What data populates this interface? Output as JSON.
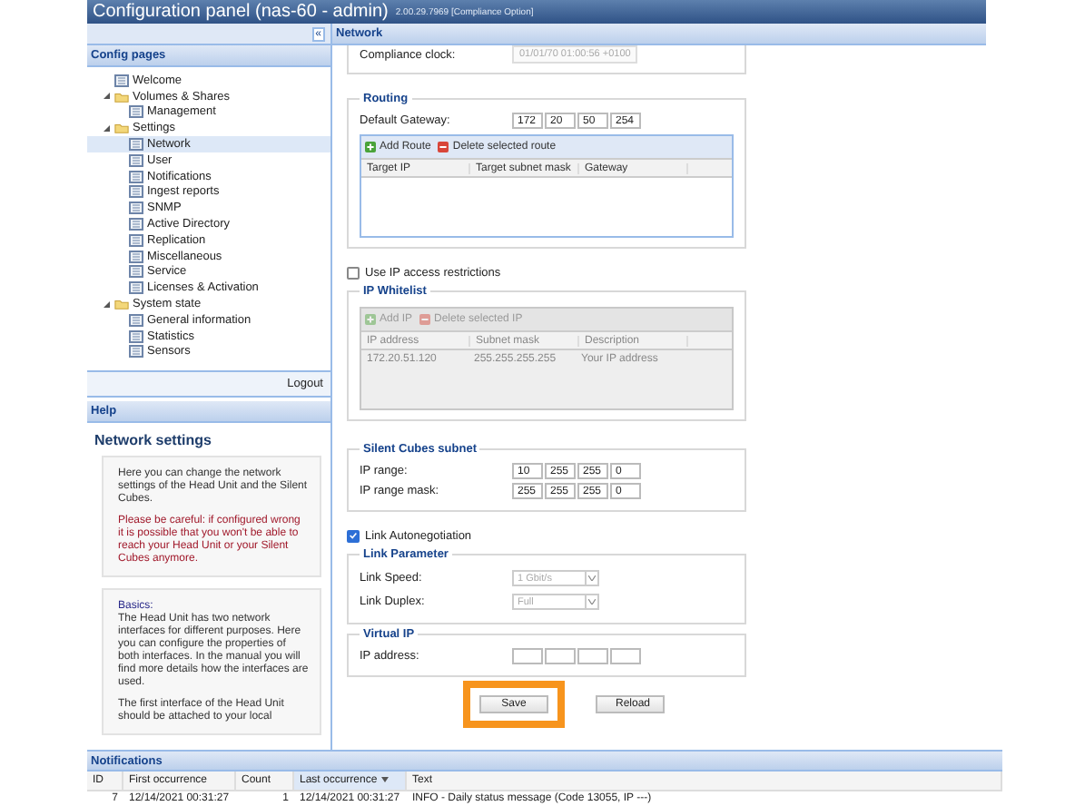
{
  "window": {
    "title": "Configuration panel (nas-60 - admin)",
    "version": "2.00.29.7969 [Compliance Option]"
  },
  "sidebar": {
    "collapse_icon": "«",
    "header": "Config pages",
    "logout": "Logout",
    "tree": [
      {
        "label": "Welcome",
        "kind": "page",
        "selected": false
      },
      {
        "label": "Volumes & Shares",
        "kind": "folder",
        "expanded": true,
        "selected": false,
        "children": [
          {
            "label": "Management",
            "kind": "page",
            "selected": false
          }
        ]
      },
      {
        "label": "Settings",
        "kind": "folder",
        "expanded": true,
        "selected": false,
        "children": [
          {
            "label": "Network",
            "kind": "page",
            "selected": true
          },
          {
            "label": "User",
            "kind": "page",
            "selected": false
          },
          {
            "label": "Notifications",
            "kind": "page",
            "selected": false
          },
          {
            "label": "Ingest reports",
            "kind": "page",
            "selected": false
          },
          {
            "label": "SNMP",
            "kind": "page",
            "selected": false
          },
          {
            "label": "Active Directory",
            "kind": "page",
            "selected": false
          },
          {
            "label": "Replication",
            "kind": "page",
            "selected": false
          },
          {
            "label": "Miscellaneous",
            "kind": "page",
            "selected": false
          },
          {
            "label": "Service",
            "kind": "page",
            "selected": false
          },
          {
            "label": "Licenses & Activation",
            "kind": "page",
            "selected": false
          }
        ]
      },
      {
        "label": "System state",
        "kind": "folder",
        "expanded": true,
        "selected": false,
        "children": [
          {
            "label": "General information",
            "kind": "page",
            "selected": false
          },
          {
            "label": "Statistics",
            "kind": "page",
            "selected": false
          },
          {
            "label": "Sensors",
            "kind": "page",
            "selected": false
          }
        ]
      }
    ]
  },
  "help": {
    "header": "Help",
    "title": "Network settings",
    "boxes": [
      [
        {
          "kind": "normal",
          "text": "Here you can change the network settings of the Head Unit and the Silent Cubes."
        },
        {
          "kind": "warning",
          "text": "Please be careful: if configured wrong it is possible that you won't be able to reach your Head Unit or your Silent Cubes anymore."
        }
      ],
      [
        {
          "kind": "heading",
          "text": "Basics:"
        },
        {
          "kind": "normal",
          "text": "The Head Unit has two network interfaces for different purposes. Here you can configure the properties of both interfaces. In the manual you will find more details how the interfaces are used."
        },
        {
          "kind": "normal",
          "text": "The first interface of the Head Unit should be attached to your local"
        }
      ]
    ]
  },
  "main": {
    "header": "Network",
    "compliance_clock": {
      "label": "Compliance clock:",
      "value": "01/01/70 01:00:56 +0100"
    },
    "routing": {
      "legend": "Routing",
      "gateway_label": "Default Gateway:",
      "gateway": [
        "172",
        "20",
        "50",
        "254"
      ],
      "toolbar": [
        {
          "label": "Add Route",
          "kind": "add",
          "disabled": false
        },
        {
          "label": "Delete selected route",
          "kind": "delete",
          "disabled": false
        }
      ],
      "columns": [
        "Target IP",
        "Target subnet mask",
        "Gateway"
      ]
    },
    "ip_restrictions": {
      "label": "Use IP access restrictions",
      "checked": false
    },
    "whitelist": {
      "legend": "IP Whitelist",
      "disabled": true,
      "toolbar": [
        {
          "label": "Add IP",
          "kind": "add",
          "disabled": true
        },
        {
          "label": "Delete selected IP",
          "kind": "delete",
          "disabled": true
        }
      ],
      "columns": [
        "IP address",
        "Subnet mask",
        "Description"
      ],
      "rows": [
        [
          "172.20.51.120",
          "255.255.255.255",
          "Your IP address"
        ]
      ]
    },
    "silent_cubes": {
      "legend": "Silent Cubes subnet",
      "rows": [
        {
          "label": "IP range:",
          "octets": [
            "10",
            "255",
            "255",
            "0"
          ]
        },
        {
          "label": "IP range mask:",
          "octets": [
            "255",
            "255",
            "255",
            "0"
          ]
        }
      ]
    },
    "autonegotiation": {
      "label": "Link Autonegotiation",
      "checked": true
    },
    "link_parameter": {
      "legend": "Link Parameter",
      "rows": [
        {
          "label": "Link Speed:",
          "value": "1 Gbit/s",
          "disabled": true
        },
        {
          "label": "Link Duplex:",
          "value": "Full",
          "disabled": true
        }
      ]
    },
    "virtual_ip": {
      "legend": "Virtual IP",
      "label": "IP address:"
    },
    "buttons": [
      {
        "label": "Save",
        "highlighted": true
      },
      {
        "label": "Reload",
        "highlighted": false
      }
    ]
  },
  "notifications": {
    "header": "Notifications",
    "columns": [
      {
        "label": "ID",
        "sorted": false
      },
      {
        "label": "First occurrence",
        "sorted": false
      },
      {
        "label": "Count",
        "sorted": false
      },
      {
        "label": "Last occurrence",
        "sorted": true
      },
      {
        "label": "Text",
        "sorted": false
      }
    ],
    "rows": [
      [
        "7",
        "12/14/2021 00:31:27",
        "1",
        "12/14/2021 00:31:27",
        "INFO - Daily status message (Code 13055, IP ---)"
      ]
    ]
  }
}
